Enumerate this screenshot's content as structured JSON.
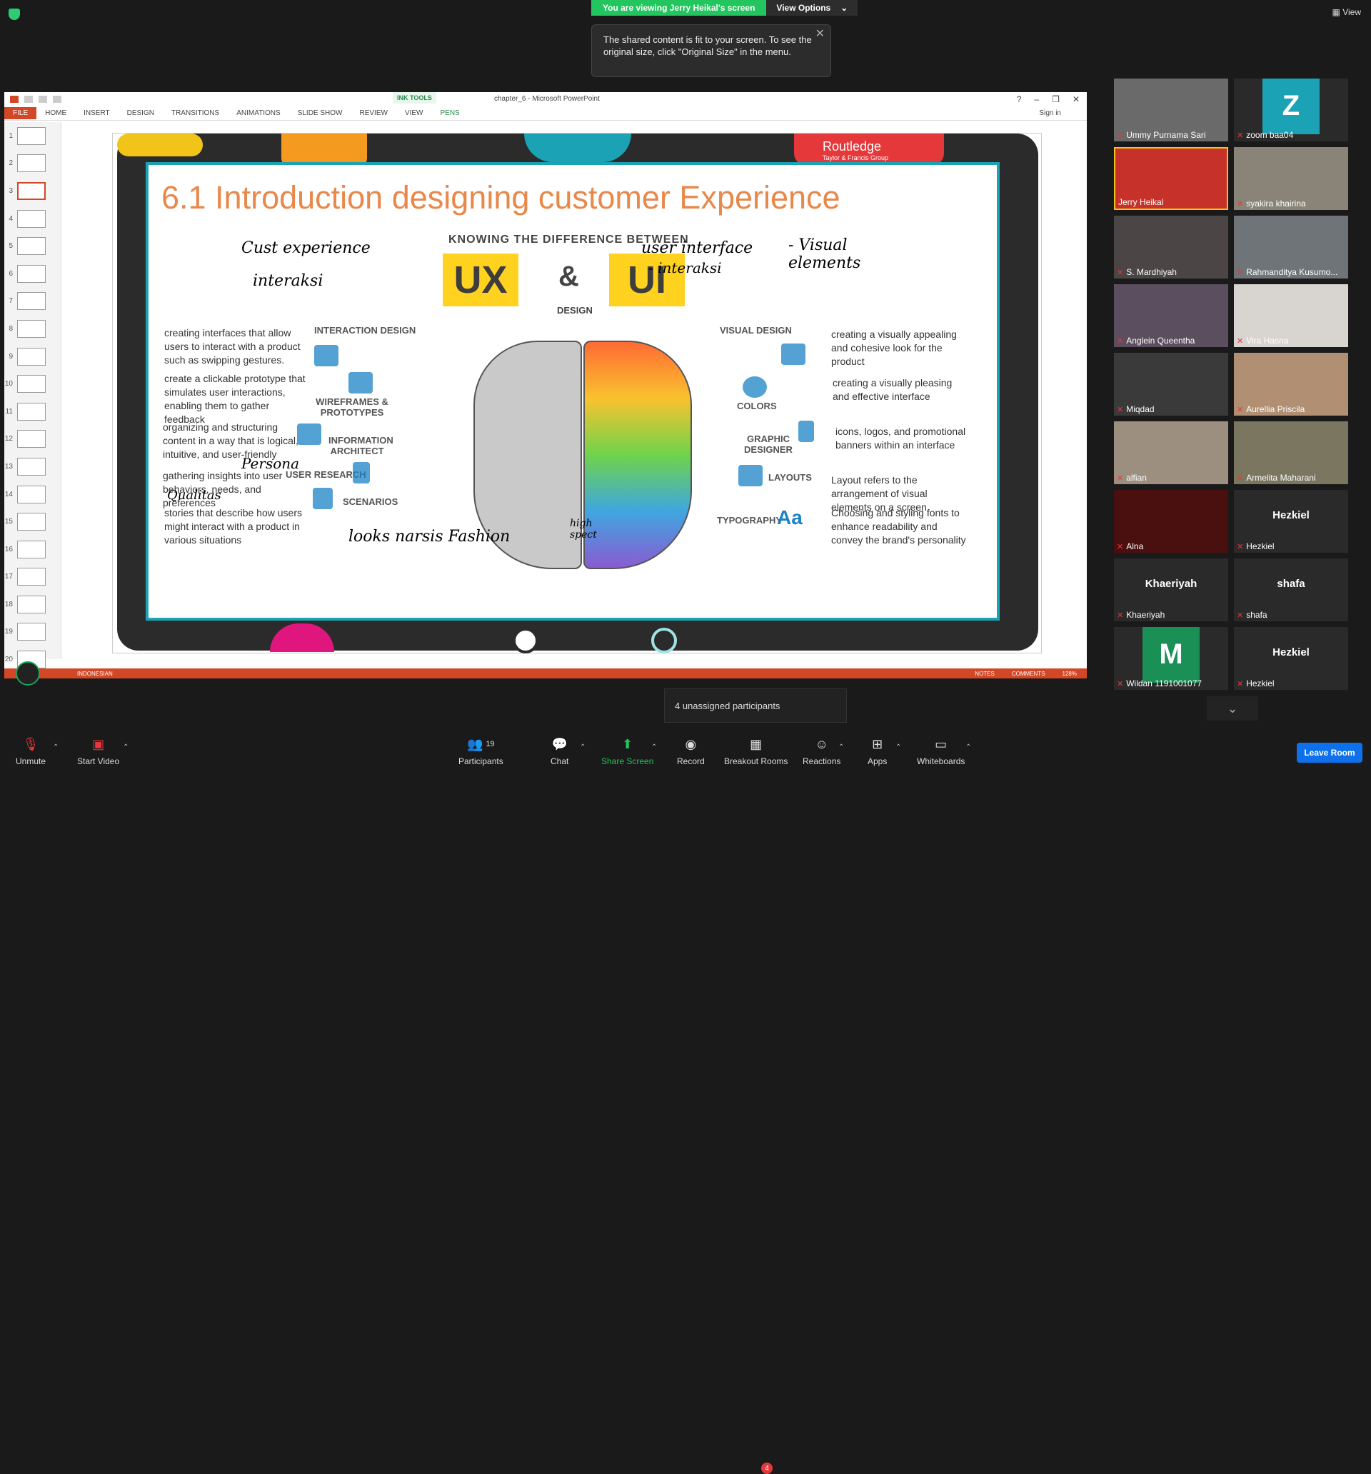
{
  "banner": {
    "viewing": "You are viewing Jerry Heikal's screen",
    "options": "View Options"
  },
  "top_right": {
    "view": "View"
  },
  "tooltip": {
    "text": "The shared content is fit to your screen. To see the original size, click \"Original Size\" in the menu."
  },
  "ppt": {
    "doc_title": "chapter_6 - Microsoft PowerPoint",
    "ink_tools": "INK TOOLS",
    "tabs": [
      "FILE",
      "HOME",
      "INSERT",
      "DESIGN",
      "TRANSITIONS",
      "ANIMATIONS",
      "SLIDE SHOW",
      "REVIEW",
      "VIEW",
      "PENS"
    ],
    "sign_in": "Sign in",
    "thumbs": [
      "1",
      "2",
      "3",
      "4",
      "5",
      "6",
      "7",
      "8",
      "9",
      "10",
      "11",
      "12",
      "13",
      "14",
      "15",
      "16",
      "17",
      "18",
      "19",
      "20"
    ],
    "status": {
      "language": "INDONESIAN",
      "notes": "NOTES",
      "comments": "COMMENTS",
      "zoom": "128%"
    }
  },
  "slide": {
    "title": "6.1 Introduction designing customer Experience",
    "publisher": "Routledge",
    "publisher_sub": "Taylor & Francis Group",
    "knowing": "KNOWING THE DIFFERENCE BETWEEN",
    "ux": "UX",
    "amp": "&",
    "ui": "UI",
    "design_tag": "DESIGN",
    "left_texts": [
      "creating interfaces that allow users to interact with a product such as swipping gestures.",
      "create a clickable prototype that simulates user interactions, enabling them to gather feedback",
      "organizing and structuring content in a way that is logical, intuitive, and user-friendly",
      "gathering insights into user behaviors, needs, and preferences",
      "stories that describe how users might interact with a product in various situations"
    ],
    "left_cats": [
      "INTERACTION DESIGN",
      "WIREFRAMES & PROTOTYPES",
      "INFORMATION ARCHITECT",
      "USER RESEARCH",
      "SCENARIOS"
    ],
    "right_cats": [
      "VISUAL DESIGN",
      "COLORS",
      "GRAPHIC DESIGNER",
      "LAYOUTS",
      "TYPOGRAPHY"
    ],
    "typography_symbol": "Aa",
    "right_texts": [
      "creating a visually appealing and cohesive look for the product",
      "creating a visually pleasing and effective interface",
      "icons, logos, and promotional banners within an interface",
      "Layout refers to the arrangement of visual elements on a screen",
      "Choosing and styling fonts to enhance readability and convey the brand's personality"
    ],
    "ink": [
      "Cust experience",
      "interaksi",
      "user interface",
      "- interaksi",
      "- Visual elements",
      "Persona",
      "Qualitas",
      "looks narsis Fashion",
      "high spect"
    ]
  },
  "gallery": [
    {
      "name": "Ummy Purnama Sari",
      "type": "video",
      "bg": "#6a6a6a"
    },
    {
      "name": "zoom baa04",
      "type": "avatar",
      "letter": "Z",
      "bg": "#1ba3b5"
    },
    {
      "name": "Jerry Heikal",
      "type": "video",
      "bg": "#c6322a",
      "highlight": true
    },
    {
      "name": "syakira khairina",
      "type": "video",
      "bg": "#8a8478"
    },
    {
      "name": "S. Mardhiyah",
      "type": "video",
      "bg": "#4b4545"
    },
    {
      "name": "Rahmanditya Kusumo...",
      "type": "video",
      "bg": "#6e7478"
    },
    {
      "name": "Anglein Queentha",
      "type": "video",
      "bg": "#5b4e5e"
    },
    {
      "name": "Vira Hasna",
      "type": "video",
      "bg": "#d8d4d0"
    },
    {
      "name": "Miqdad",
      "type": "video",
      "bg": "#3a3a3a"
    },
    {
      "name": "Aurellia Priscila",
      "type": "video",
      "bg": "#b08f72"
    },
    {
      "name": "alfian",
      "type": "video",
      "bg": "#9d8f80"
    },
    {
      "name": "Armelita Maharani",
      "type": "video",
      "bg": "#7a7660"
    },
    {
      "name": "Alna",
      "type": "video",
      "bg": "#4a1010"
    },
    {
      "name": "Hezkiel",
      "type": "name",
      "label": "Hezkiel"
    },
    {
      "name": "Khaeriyah",
      "type": "name",
      "label": "Khaeriyah"
    },
    {
      "name": "shafa",
      "type": "name",
      "label": "shafa"
    },
    {
      "name": "Wildan 1191001077",
      "type": "avatar",
      "letter": "M",
      "bg": "#1a8f56"
    },
    {
      "name": "Hezkiel",
      "type": "name",
      "label": "Hezkiel"
    }
  ],
  "unassigned": "4 unassigned participants",
  "toolbar": {
    "unmute": "Unmute",
    "start_video": "Start Video",
    "participants": "Participants",
    "participants_count": "19",
    "chat": "Chat",
    "share": "Share Screen",
    "record": "Record",
    "breakout": "Breakout Rooms",
    "breakout_count": "4",
    "reactions": "Reactions",
    "apps": "Apps",
    "whiteboards": "Whiteboards",
    "leave": "Leave Room"
  }
}
